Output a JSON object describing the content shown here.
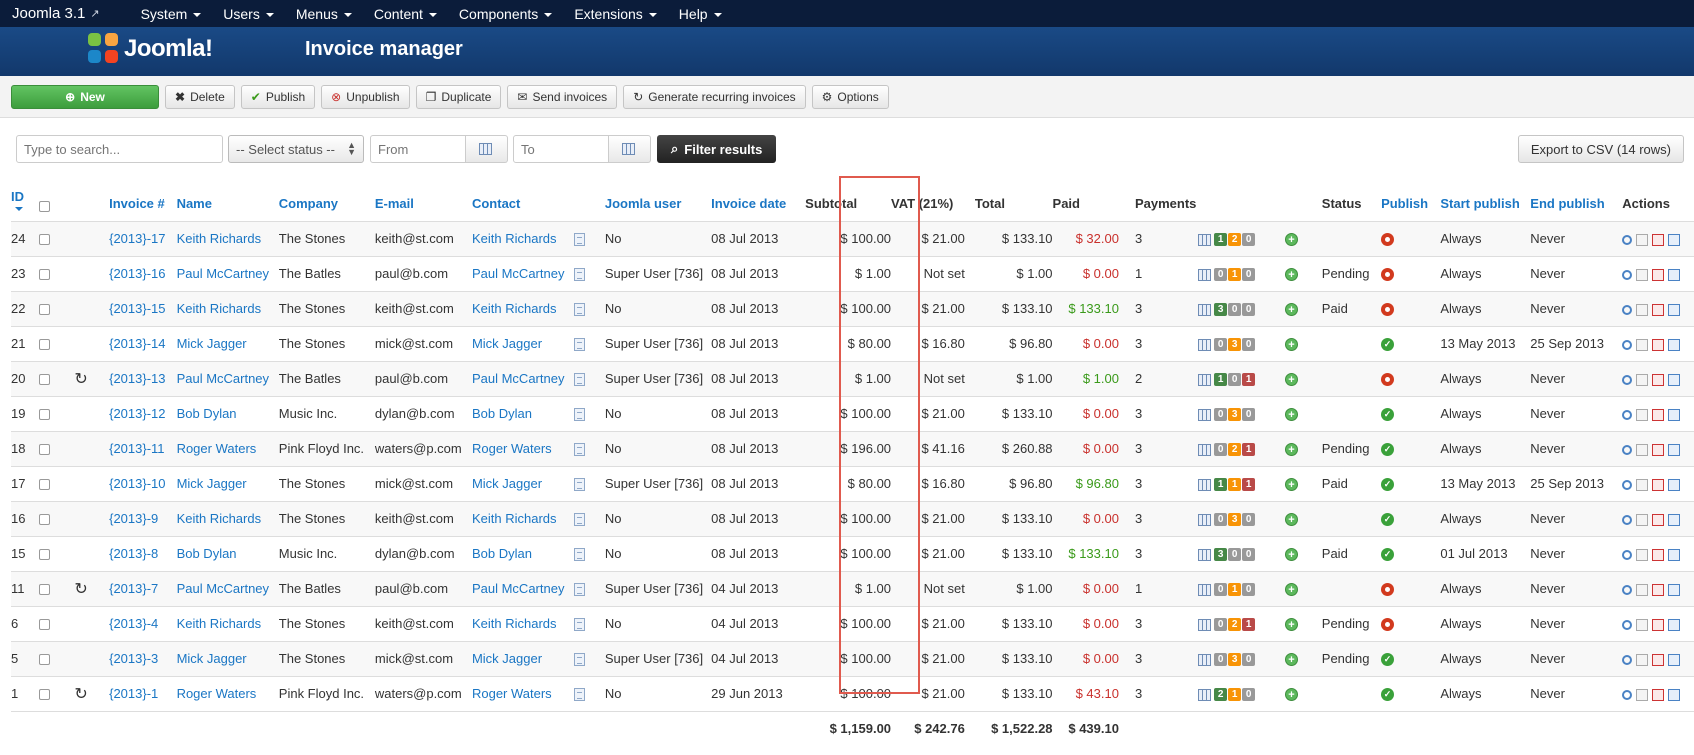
{
  "adminbar": {
    "brand": "Joomla 3.1",
    "menu": [
      "System",
      "Users",
      "Menus",
      "Content",
      "Components",
      "Extensions",
      "Help"
    ]
  },
  "header": {
    "logo_text": "Joomla!",
    "title": "Invoice manager"
  },
  "toolbar": {
    "new": "New",
    "delete": "Delete",
    "publish": "Publish",
    "unpublish": "Unpublish",
    "duplicate": "Duplicate",
    "send": "Send invoices",
    "recurring": "Generate recurring invoices",
    "options": "Options"
  },
  "filters": {
    "search_placeholder": "Type to search...",
    "status": "-- Select status --",
    "from_placeholder": "From",
    "to_placeholder": "To",
    "filter_button": "Filter results",
    "export_button": "Export to CSV (14 rows)"
  },
  "columns": {
    "id": "ID",
    "invoice": "Invoice #",
    "name": "Name",
    "company": "Company",
    "email": "E-mail",
    "contact": "Contact",
    "juser": "Joomla user",
    "date": "Invoice date",
    "subtotal": "Subtotal",
    "vat": "VAT (21%)",
    "total": "Total",
    "paid": "Paid",
    "payments": "Payments",
    "status": "Status",
    "publish": "Publish",
    "start": "Start publish",
    "end": "End publish",
    "actions": "Actions"
  },
  "colors": {
    "link": "#1a76c4",
    "unpaid": "#c9302c",
    "paid": "#3a9a1a",
    "highlight": "#e05a4e"
  },
  "rows": [
    {
      "id": "24",
      "rec": false,
      "inv": "{2013}-17",
      "name": "Keith Richards",
      "company": "The Stones",
      "email": "keith@st.com",
      "contact": "Keith Richards",
      "juser": "No",
      "date": "08 Jul 2013",
      "subtotal": "$ 100.00",
      "vat": "$ 21.00",
      "total": "$ 133.10",
      "paid": "$ 32.00",
      "paidColor": "red",
      "count": "3",
      "badges": [
        [
          "1",
          "green"
        ],
        [
          "2",
          "orange"
        ],
        [
          "0",
          "grey"
        ]
      ],
      "status": "",
      "pub": "off",
      "start": "Always",
      "end": "Never"
    },
    {
      "id": "23",
      "rec": false,
      "inv": "{2013}-16",
      "name": "Paul McCartney",
      "company": "The Batles",
      "email": "paul@b.com",
      "contact": "Paul McCartney",
      "juser": "Super User [736]",
      "date": "08 Jul 2013",
      "subtotal": "$ 1.00",
      "vat": "Not set",
      "total": "$ 1.00",
      "paid": "$ 0.00",
      "paidColor": "red",
      "count": "1",
      "badges": [
        [
          "0",
          "grey"
        ],
        [
          "1",
          "orange"
        ],
        [
          "0",
          "grey"
        ]
      ],
      "status": "Pending",
      "pub": "off",
      "start": "Always",
      "end": "Never"
    },
    {
      "id": "22",
      "rec": false,
      "inv": "{2013}-15",
      "name": "Keith Richards",
      "company": "The Stones",
      "email": "keith@st.com",
      "contact": "Keith Richards",
      "juser": "No",
      "date": "08 Jul 2013",
      "subtotal": "$ 100.00",
      "vat": "$ 21.00",
      "total": "$ 133.10",
      "paid": "$ 133.10",
      "paidColor": "green",
      "count": "3",
      "badges": [
        [
          "3",
          "green"
        ],
        [
          "0",
          "grey"
        ],
        [
          "0",
          "grey"
        ]
      ],
      "status": "Paid",
      "pub": "off",
      "start": "Always",
      "end": "Never"
    },
    {
      "id": "21",
      "rec": false,
      "inv": "{2013}-14",
      "name": "Mick Jagger",
      "company": "The Stones",
      "email": "mick@st.com",
      "contact": "Mick Jagger",
      "juser": "Super User [736]",
      "date": "08 Jul 2013",
      "subtotal": "$ 80.00",
      "vat": "$ 16.80",
      "total": "$ 96.80",
      "paid": "$ 0.00",
      "paidColor": "red",
      "count": "3",
      "badges": [
        [
          "0",
          "grey"
        ],
        [
          "3",
          "orange"
        ],
        [
          "0",
          "grey"
        ]
      ],
      "status": "",
      "pub": "on",
      "start": "13 May 2013",
      "end": "25 Sep 2013"
    },
    {
      "id": "20",
      "rec": true,
      "inv": "{2013}-13",
      "name": "Paul McCartney",
      "company": "The Batles",
      "email": "paul@b.com",
      "contact": "Paul McCartney",
      "juser": "Super User [736]",
      "date": "08 Jul 2013",
      "subtotal": "$ 1.00",
      "vat": "Not set",
      "total": "$ 1.00",
      "paid": "$ 1.00",
      "paidColor": "green",
      "count": "2",
      "badges": [
        [
          "1",
          "green"
        ],
        [
          "0",
          "grey"
        ],
        [
          "1",
          "red"
        ]
      ],
      "status": "",
      "pub": "off",
      "start": "Always",
      "end": "Never"
    },
    {
      "id": "19",
      "rec": false,
      "inv": "{2013}-12",
      "name": "Bob Dylan",
      "company": "Music Inc.",
      "email": "dylan@b.com",
      "contact": "Bob Dylan",
      "juser": "No",
      "date": "08 Jul 2013",
      "subtotal": "$ 100.00",
      "vat": "$ 21.00",
      "total": "$ 133.10",
      "paid": "$ 0.00",
      "paidColor": "red",
      "count": "3",
      "badges": [
        [
          "0",
          "grey"
        ],
        [
          "3",
          "orange"
        ],
        [
          "0",
          "grey"
        ]
      ],
      "status": "",
      "pub": "on",
      "start": "Always",
      "end": "Never"
    },
    {
      "id": "18",
      "rec": false,
      "inv": "{2013}-11",
      "name": "Roger Waters",
      "company": "Pink Floyd Inc.",
      "email": "waters@p.com",
      "contact": "Roger Waters",
      "juser": "No",
      "date": "08 Jul 2013",
      "subtotal": "$ 196.00",
      "vat": "$ 41.16",
      "total": "$ 260.88",
      "paid": "$ 0.00",
      "paidColor": "red",
      "count": "3",
      "badges": [
        [
          "0",
          "grey"
        ],
        [
          "2",
          "orange"
        ],
        [
          "1",
          "red"
        ]
      ],
      "status": "Pending",
      "pub": "on",
      "start": "Always",
      "end": "Never"
    },
    {
      "id": "17",
      "rec": false,
      "inv": "{2013}-10",
      "name": "Mick Jagger",
      "company": "The Stones",
      "email": "mick@st.com",
      "contact": "Mick Jagger",
      "juser": "Super User [736]",
      "date": "08 Jul 2013",
      "subtotal": "$ 80.00",
      "vat": "$ 16.80",
      "total": "$ 96.80",
      "paid": "$ 96.80",
      "paidColor": "green",
      "count": "3",
      "badges": [
        [
          "1",
          "green"
        ],
        [
          "1",
          "orange"
        ],
        [
          "1",
          "red"
        ]
      ],
      "status": "Paid",
      "pub": "on",
      "start": "13 May 2013",
      "end": "25 Sep 2013"
    },
    {
      "id": "16",
      "rec": false,
      "inv": "{2013}-9",
      "name": "Keith Richards",
      "company": "The Stones",
      "email": "keith@st.com",
      "contact": "Keith Richards",
      "juser": "No",
      "date": "08 Jul 2013",
      "subtotal": "$ 100.00",
      "vat": "$ 21.00",
      "total": "$ 133.10",
      "paid": "$ 0.00",
      "paidColor": "red",
      "count": "3",
      "badges": [
        [
          "0",
          "grey"
        ],
        [
          "3",
          "orange"
        ],
        [
          "0",
          "grey"
        ]
      ],
      "status": "",
      "pub": "on",
      "start": "Always",
      "end": "Never"
    },
    {
      "id": "15",
      "rec": false,
      "inv": "{2013}-8",
      "name": "Bob Dylan",
      "company": "Music Inc.",
      "email": "dylan@b.com",
      "contact": "Bob Dylan",
      "juser": "No",
      "date": "08 Jul 2013",
      "subtotal": "$ 100.00",
      "vat": "$ 21.00",
      "total": "$ 133.10",
      "paid": "$ 133.10",
      "paidColor": "green",
      "count": "3",
      "badges": [
        [
          "3",
          "green"
        ],
        [
          "0",
          "grey"
        ],
        [
          "0",
          "grey"
        ]
      ],
      "status": "Paid",
      "pub": "on",
      "start": "01 Jul 2013",
      "end": "Never"
    },
    {
      "id": "11",
      "rec": true,
      "inv": "{2013}-7",
      "name": "Paul McCartney",
      "company": "The Batles",
      "email": "paul@b.com",
      "contact": "Paul McCartney",
      "juser": "Super User [736]",
      "date": "04 Jul 2013",
      "subtotal": "$ 1.00",
      "vat": "Not set",
      "total": "$ 1.00",
      "paid": "$ 0.00",
      "paidColor": "red",
      "count": "1",
      "badges": [
        [
          "0",
          "grey"
        ],
        [
          "1",
          "orange"
        ],
        [
          "0",
          "grey"
        ]
      ],
      "status": "",
      "pub": "off",
      "start": "Always",
      "end": "Never"
    },
    {
      "id": "6",
      "rec": false,
      "inv": "{2013}-4",
      "name": "Keith Richards",
      "company": "The Stones",
      "email": "keith@st.com",
      "contact": "Keith Richards",
      "juser": "No",
      "date": "04 Jul 2013",
      "subtotal": "$ 100.00",
      "vat": "$ 21.00",
      "total": "$ 133.10",
      "paid": "$ 0.00",
      "paidColor": "red",
      "count": "3",
      "badges": [
        [
          "0",
          "grey"
        ],
        [
          "2",
          "orange"
        ],
        [
          "1",
          "red"
        ]
      ],
      "status": "Pending",
      "pub": "off",
      "start": "Always",
      "end": "Never"
    },
    {
      "id": "5",
      "rec": false,
      "inv": "{2013}-3",
      "name": "Mick Jagger",
      "company": "The Stones",
      "email": "mick@st.com",
      "contact": "Mick Jagger",
      "juser": "Super User [736]",
      "date": "04 Jul 2013",
      "subtotal": "$ 100.00",
      "vat": "$ 21.00",
      "total": "$ 133.10",
      "paid": "$ 0.00",
      "paidColor": "red",
      "count": "3",
      "badges": [
        [
          "0",
          "grey"
        ],
        [
          "3",
          "orange"
        ],
        [
          "0",
          "grey"
        ]
      ],
      "status": "Pending",
      "pub": "on",
      "start": "Always",
      "end": "Never"
    },
    {
      "id": "1",
      "rec": true,
      "inv": "{2013}-1",
      "name": "Roger Waters",
      "company": "Pink Floyd Inc.",
      "email": "waters@p.com",
      "contact": "Roger Waters",
      "juser": "No",
      "date": "29 Jun 2013",
      "subtotal": "$ 100.00",
      "vat": "$ 21.00",
      "total": "$ 133.10",
      "paid": "$ 43.10",
      "paidColor": "red",
      "count": "3",
      "badges": [
        [
          "2",
          "green"
        ],
        [
          "1",
          "orange"
        ],
        [
          "0",
          "grey"
        ]
      ],
      "status": "",
      "pub": "on",
      "start": "Always",
      "end": "Never"
    }
  ],
  "totals": {
    "subtotal": "$ 1,159.00",
    "vat": "$ 242.76",
    "total": "$ 1,522.28",
    "paid": "$ 439.10"
  }
}
